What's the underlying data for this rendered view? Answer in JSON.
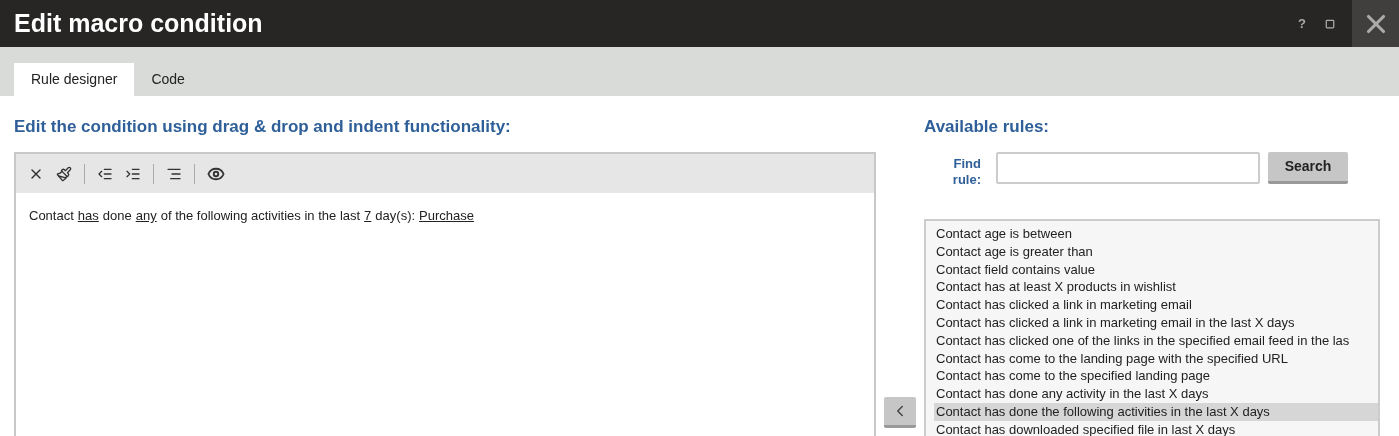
{
  "window": {
    "title": "Edit macro condition",
    "buttons": [
      "?"
    ]
  },
  "tabs": [
    {
      "label": "Rule designer",
      "selected": true
    },
    {
      "label": "Code",
      "selected": false
    }
  ],
  "editor": {
    "heading": "Edit the condition using drag & drop and indent functionality:",
    "condition": [
      {
        "kind": "text",
        "text": "Contact"
      },
      {
        "kind": "link",
        "text": "has"
      },
      {
        "kind": "text",
        "text": "done"
      },
      {
        "kind": "link",
        "text": "any"
      },
      {
        "kind": "text",
        "text": "of the following activities in the last"
      },
      {
        "kind": "link",
        "text": "7"
      },
      {
        "kind": "text",
        "text": "day(s):"
      },
      {
        "kind": "link",
        "text": "Purchase"
      }
    ]
  },
  "rules": {
    "heading": "Available rules:",
    "find_label": "Find rule:",
    "search_button": "Search",
    "items": [
      {
        "label": "Contact age is between",
        "selected": false
      },
      {
        "label": "Contact age is greater than",
        "selected": false
      },
      {
        "label": "Contact field contains value",
        "selected": false
      },
      {
        "label": "Contact has at least X products in wishlist",
        "selected": false
      },
      {
        "label": "Contact has clicked a link in marketing email",
        "selected": false
      },
      {
        "label": "Contact has clicked a link in marketing email in the last X days",
        "selected": false
      },
      {
        "label": "Contact has clicked one of the links in the specified email feed in the las",
        "selected": false
      },
      {
        "label": "Contact has come to the landing page with the specified URL",
        "selected": false
      },
      {
        "label": "Contact has come to the specified landing page",
        "selected": false
      },
      {
        "label": "Contact has done any activity in the last X days",
        "selected": false
      },
      {
        "label": "Contact has done the following activities in the last X days",
        "selected": true
      },
      {
        "label": "Contact has downloaded specified file in last X days",
        "selected": false
      }
    ]
  }
}
